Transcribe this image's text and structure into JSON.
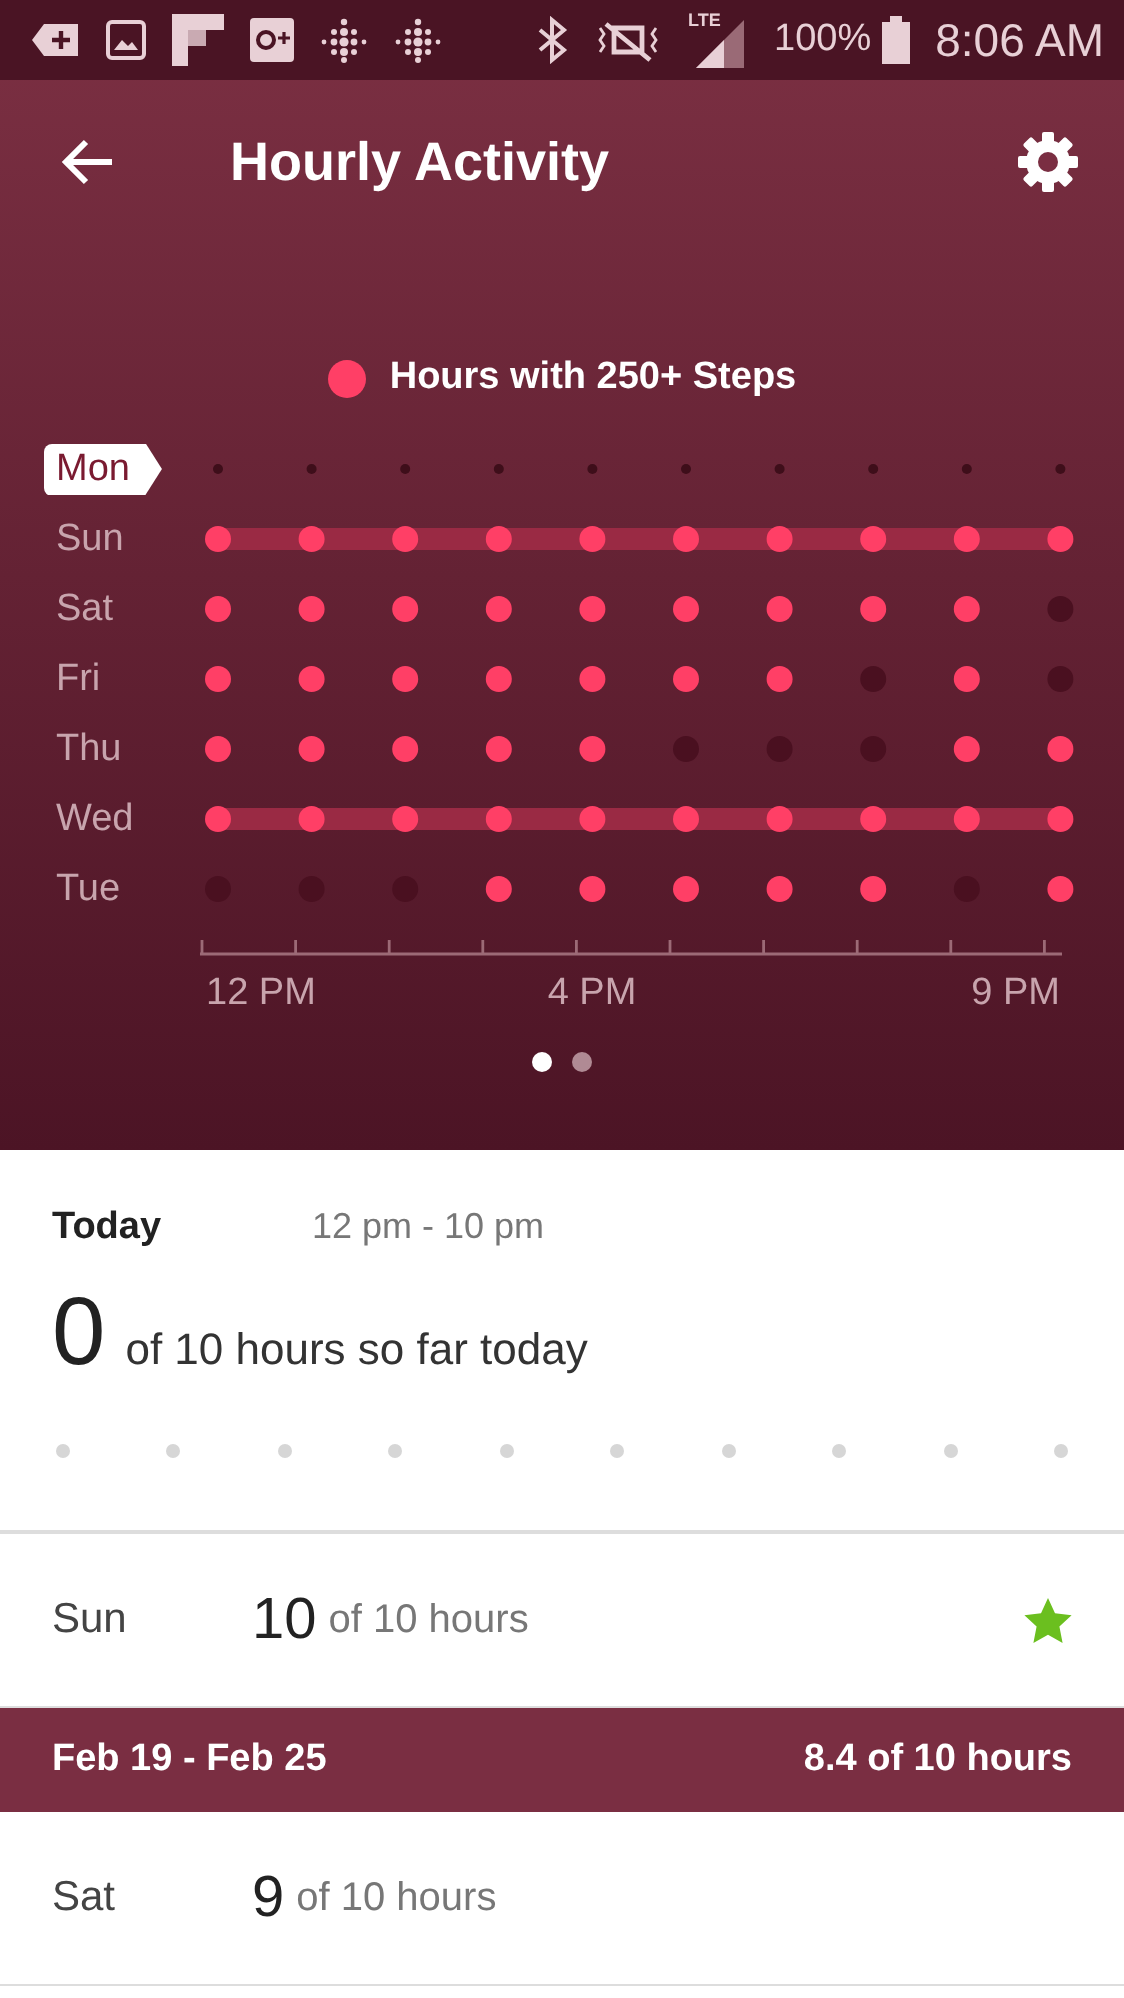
{
  "status_bar": {
    "network": "LTE",
    "battery": "100%",
    "time": "8:06 AM"
  },
  "header": {
    "title": "Hourly Activity"
  },
  "legend": {
    "label": "Hours with 250+ Steps"
  },
  "grid": {
    "rows": [
      {
        "day": "Mon",
        "selected": true,
        "kind": "today",
        "hours": [
          false,
          false,
          false,
          false,
          false,
          false,
          false,
          false,
          false,
          false
        ]
      },
      {
        "day": "Sun",
        "selected": false,
        "kind": "past",
        "hours": [
          true,
          true,
          true,
          true,
          true,
          true,
          true,
          true,
          true,
          true
        ]
      },
      {
        "day": "Sat",
        "selected": false,
        "kind": "past",
        "hours": [
          true,
          true,
          true,
          true,
          true,
          true,
          true,
          true,
          true,
          false
        ]
      },
      {
        "day": "Fri",
        "selected": false,
        "kind": "past",
        "hours": [
          true,
          true,
          true,
          true,
          true,
          true,
          true,
          false,
          true,
          false
        ]
      },
      {
        "day": "Thu",
        "selected": false,
        "kind": "past",
        "hours": [
          true,
          true,
          true,
          true,
          true,
          false,
          false,
          false,
          true,
          true
        ]
      },
      {
        "day": "Wed",
        "selected": false,
        "kind": "past",
        "hours": [
          true,
          true,
          true,
          true,
          true,
          true,
          true,
          true,
          true,
          true
        ]
      },
      {
        "day": "Tue",
        "selected": false,
        "kind": "past",
        "hours": [
          false,
          false,
          false,
          true,
          true,
          true,
          true,
          true,
          false,
          true
        ]
      }
    ],
    "axis_labels": [
      "12 PM",
      "4 PM",
      "9 PM"
    ]
  },
  "pages": [
    {
      "selected": true
    },
    {
      "selected": false
    }
  ],
  "today": {
    "label": "Today",
    "range": "12 pm - 10 pm",
    "count": "0",
    "text": "of 10 hours so far today",
    "hours": [
      false,
      false,
      false,
      false,
      false,
      false,
      false,
      false,
      false,
      false
    ]
  },
  "sections": [
    {
      "kind": "day",
      "day": "Sun",
      "count": "10",
      "text": "of 10 hours",
      "achieved": true
    },
    {
      "kind": "week",
      "range": "Feb 19 - Feb 25",
      "summary": "8.4 of 10 hours"
    },
    {
      "kind": "day",
      "day": "Sat",
      "count": "9",
      "text": "of 10 hours",
      "achieved": false
    }
  ]
}
